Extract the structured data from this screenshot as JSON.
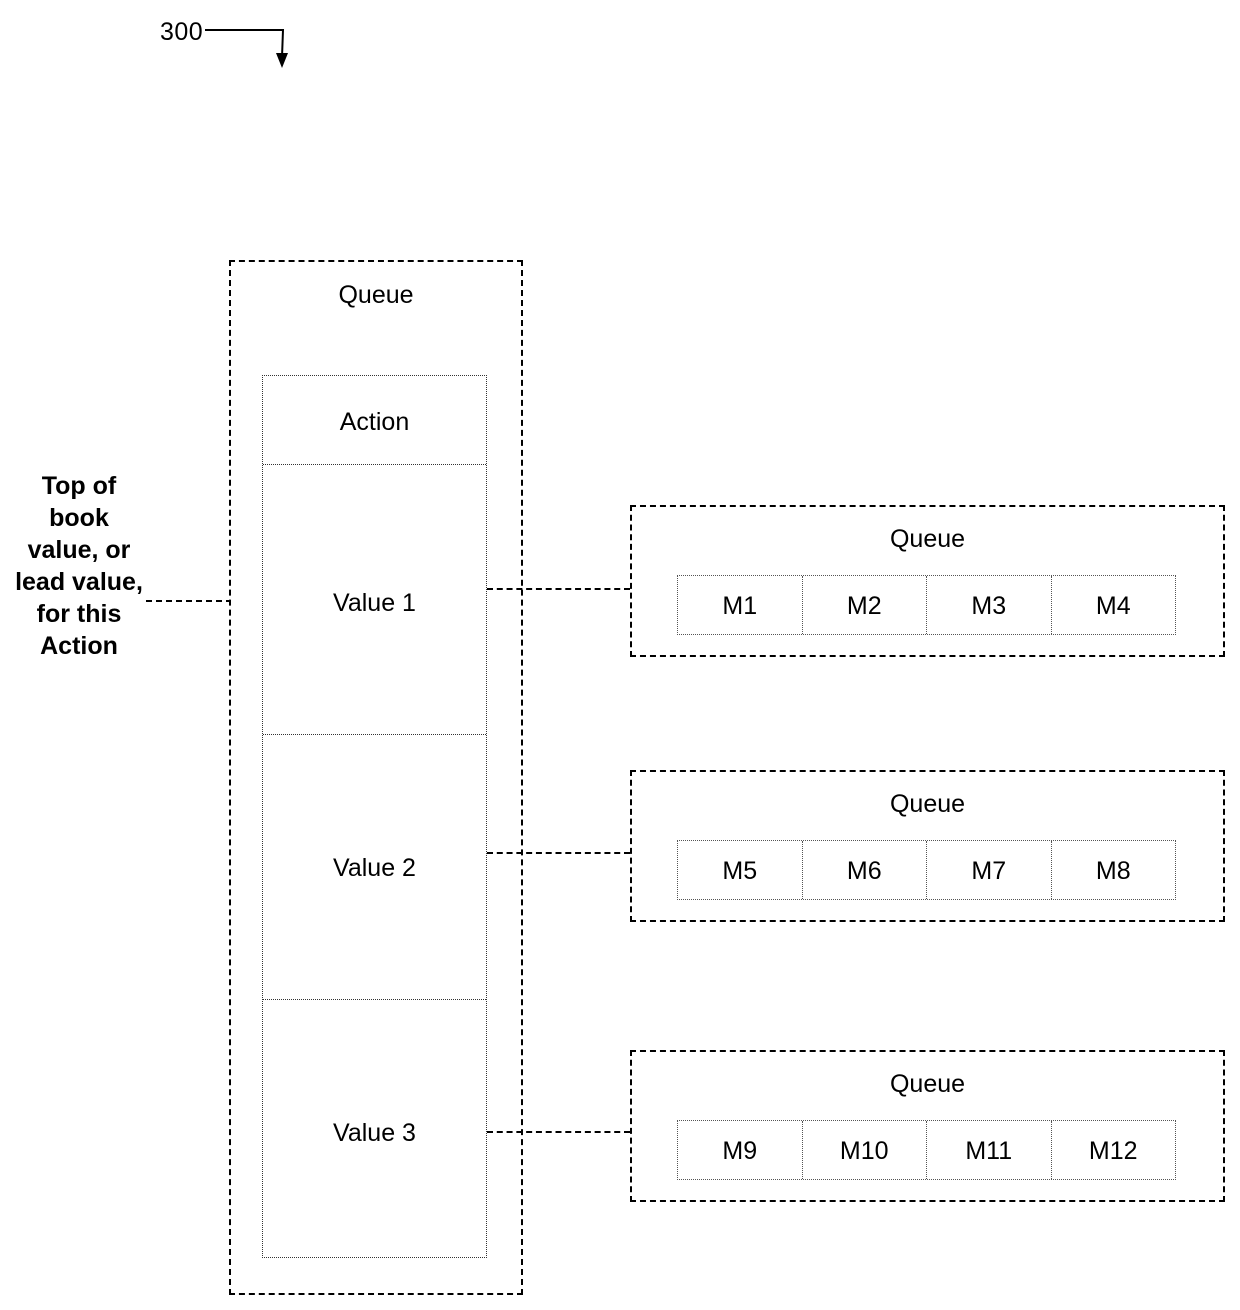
{
  "figure": {
    "reference_number": "300"
  },
  "annotations": {
    "left_caption": "Top of book value, or lead value, for this Action"
  },
  "main_queue": {
    "title": "Queue",
    "action": {
      "label": "Action",
      "values": [
        {
          "label": "Value 1"
        },
        {
          "label": "Value 2"
        },
        {
          "label": "Value 3"
        }
      ]
    }
  },
  "message_queues": [
    {
      "title": "Queue",
      "messages": [
        "M1",
        "M2",
        "M3",
        "M4"
      ]
    },
    {
      "title": "Queue",
      "messages": [
        "M5",
        "M6",
        "M7",
        "M8"
      ]
    },
    {
      "title": "Queue",
      "messages": [
        "M9",
        "M10",
        "M11",
        "M12"
      ]
    }
  ],
  "colors": {
    "stroke": "#000000",
    "background": "#ffffff",
    "dotted_stroke": "#555555"
  }
}
